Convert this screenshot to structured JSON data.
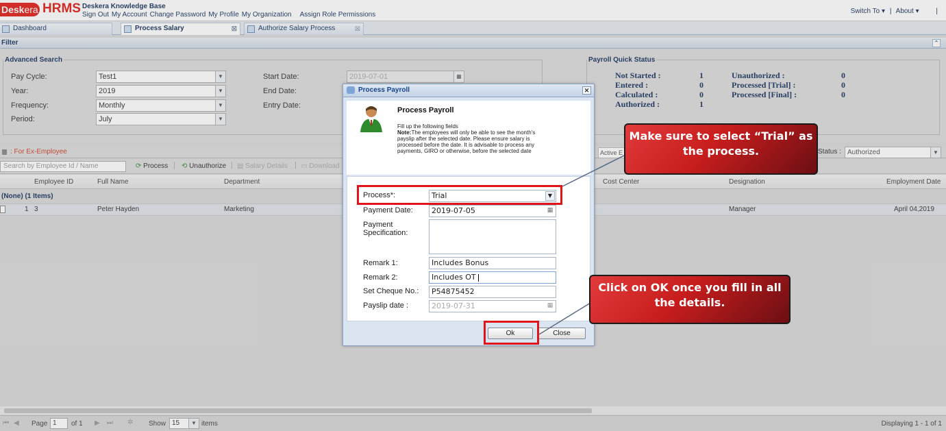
{
  "header": {
    "logo_desk": "Desk",
    "logo_era": "era",
    "logo_hrms": "HRMS",
    "kb_title": "Deskera Knowledge Base",
    "nav": [
      "Sign Out",
      "My Account",
      "Change Password",
      "My Profile",
      "My Organization",
      "Assign Role Permissions"
    ],
    "switch_to": "Switch To ▾",
    "sep": "|",
    "about": "About ▾",
    "sep2": "|"
  },
  "tabs": [
    {
      "label": "Dashboard"
    },
    {
      "label": "Process Salary"
    },
    {
      "label": "Authorize Salary Process"
    }
  ],
  "filter": {
    "header": "Filter",
    "advanced_search": "Advanced Search",
    "pay_cycle_label": "Pay Cycle:",
    "pay_cycle_value": "Test1",
    "year_label": "Year:",
    "year_value": "2019",
    "frequency_label": "Frequency:",
    "frequency_value": "Monthly",
    "period_label": "Period:",
    "period_value": "July",
    "start_date_label": "Start Date:",
    "start_date_value": "2019-07-01",
    "end_date_label": "End Date:",
    "entry_date_label": "Entry Date:"
  },
  "quick_status": {
    "title": "Payroll Quick Status",
    "not_started_label": "Not Started :",
    "not_started": "1",
    "entered_label": "Entered :",
    "entered": "0",
    "calculated_label": "Calculated :",
    "calculated": "0",
    "authorized_label": "Authorized :",
    "authorized": "1",
    "unauthorized_label": "Unauthorized :",
    "unauthorized": "0",
    "processed_trial_label": "Processed [Trial] :",
    "processed_trial": "0",
    "processed_final_label": "Processed [Final] :",
    "processed_final": "0"
  },
  "grid": {
    "ex_employee": ": For Ex-Employee",
    "search_placeholder": "Search by Employee Id / Name",
    "process_btn": "Process",
    "unauthorize_btn": "Unauthorize",
    "salary_details_btn": "Salary Details",
    "download_btn": "Download",
    "active_label": "Active E",
    "status_label": "Status :",
    "status_value": "Authorized",
    "columns": [
      "Employee ID",
      "Full Name",
      "Department",
      "Cost Center",
      "Designation",
      "Employment Date"
    ],
    "group_row": "(None) (1 Items)",
    "row": {
      "num": "1",
      "id": "3",
      "name": "Peter Hayden",
      "dept": "Marketing",
      "designation": "Manager",
      "emp_date": "April 04,2019"
    }
  },
  "pager": {
    "page": "Page",
    "page_value": "1",
    "of": "of 1",
    "show": "Show",
    "show_value": "15",
    "items": "items",
    "displaying": "Displaying 1 - 1 of 1"
  },
  "dialog": {
    "title": "Process Payroll",
    "heading": "Process Payroll",
    "intro": "Fill up the following fields",
    "note_label": "Note:",
    "note_text": "The employees will only be able to see the month's payslip after the selected date. Please ensure salary is processed before the date. It is advisable to process any payments, GIRO or otherwise, before the selected date",
    "process_label": "Process*:",
    "process_value": "Trial",
    "payment_date_label": "Payment Date:",
    "payment_date_value": "2019-07-05",
    "payment_spec_label": "Payment Specification:",
    "payment_spec_value": "",
    "remark1_label": "Remark 1:",
    "remark1_value": "Includes Bonus",
    "remark2_label": "Remark 2:",
    "remark2_value": "Includes OT",
    "cheque_label": "Set Cheque No.:",
    "cheque_value": "P54875452",
    "payslip_date_label": "Payslip date :",
    "payslip_date_value": "2019-07-31",
    "ok": "Ok",
    "close": "Close"
  },
  "callouts": {
    "trial": "Make sure to select “Trial” as the process.",
    "ok": "Click on OK once you fill in all the details."
  }
}
